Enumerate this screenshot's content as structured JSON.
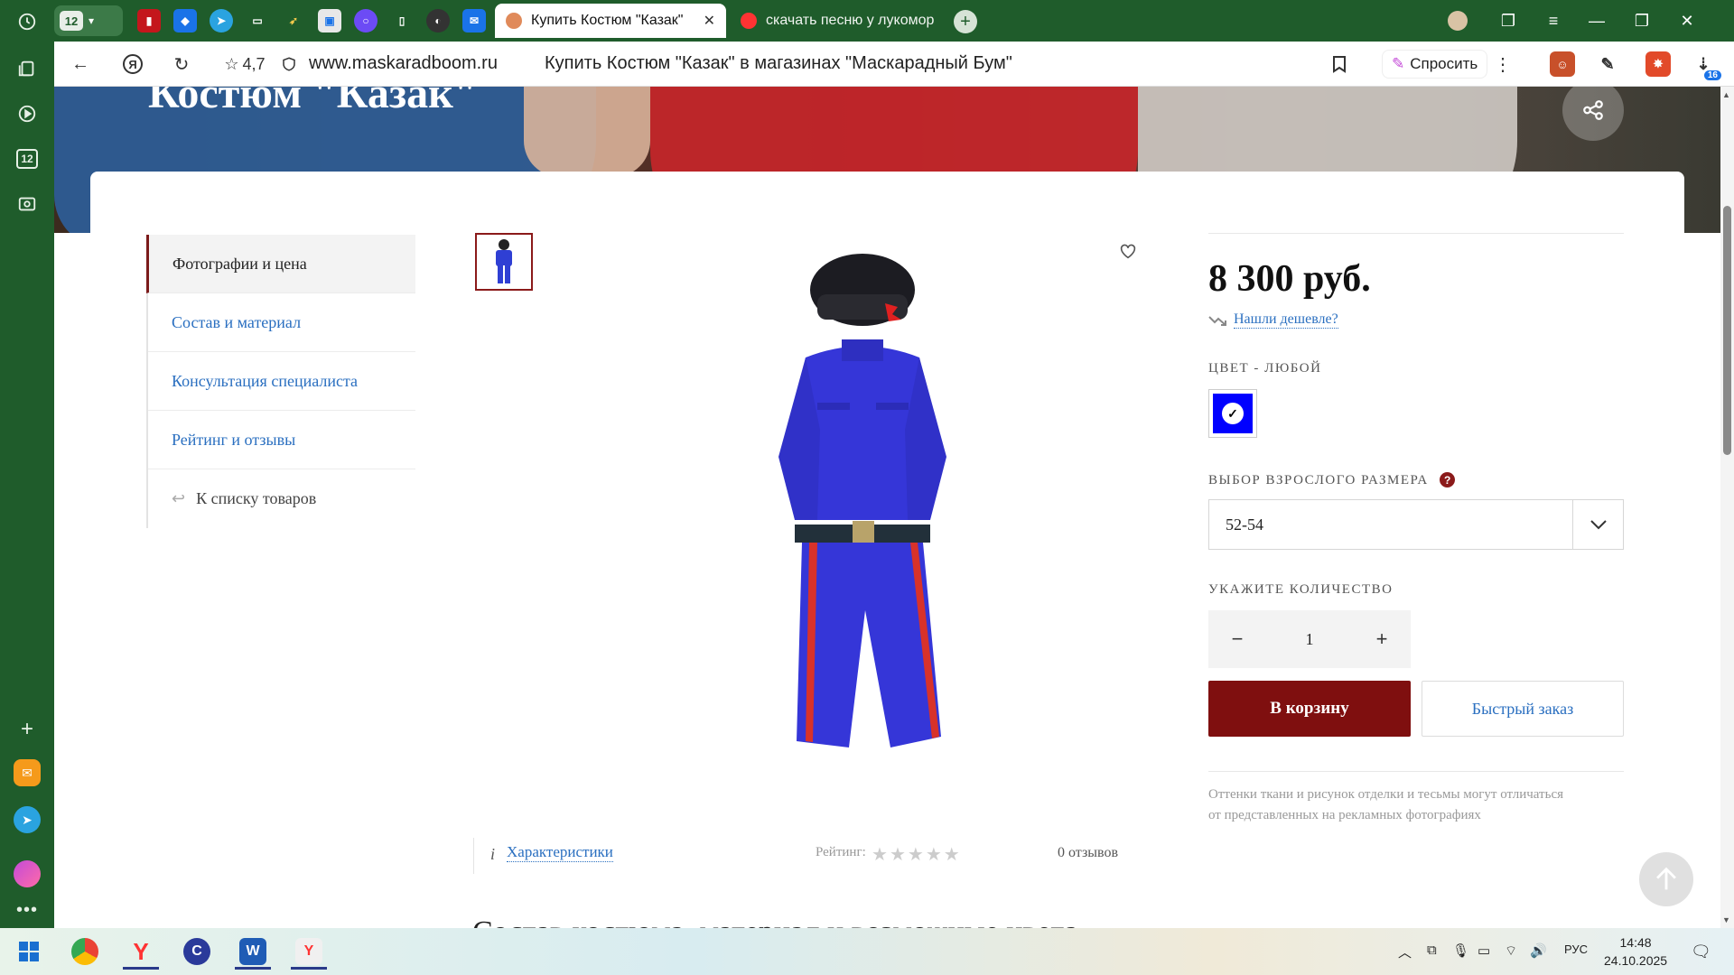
{
  "colors": {
    "chrome_green": "#1f5c2b",
    "brand_red": "#7f0f0f",
    "link_blue": "#2a6fc0",
    "swatch_blue": "#0000ff"
  },
  "browser": {
    "tab_group_count": "12",
    "tabs": [
      {
        "title": "Купить Костюм \"Казак\"",
        "active": true
      },
      {
        "title": "скачать песню у лукомор",
        "active": false
      }
    ],
    "address": {
      "rating": "4,7",
      "host": "www.maskaradboom.ru",
      "page_title": "Купить Костюм \"Казак\" в магазинах \"Маскарадный Бум\""
    },
    "ask_label": "Спросить",
    "ext_badge": "16",
    "rail_badge": "12"
  },
  "hero": {
    "title": "Костюм \"Казак\""
  },
  "sidebar": {
    "items": [
      {
        "label": "Фотографии и цена"
      },
      {
        "label": "Состав и материал"
      },
      {
        "label": "Консультация специалиста"
      },
      {
        "label": "Рейтинг и отзывы"
      }
    ],
    "back_label": "К списку товаров"
  },
  "product": {
    "info_link": "Характеристики",
    "rating_label": "Рейтинг:",
    "rating_value": 0,
    "reviews": "0 отзывов",
    "section_heading": "Состав костюма, материал и возможные цвета"
  },
  "buy": {
    "price": "8 300 руб.",
    "cheaper_link": "Нашли дешевле?",
    "color_label": "ЦВЕТ - ЛЮБОЙ",
    "size_label": "ВЫБОР ВЗРОСЛОГО РАЗМЕРА",
    "size_value": "52-54",
    "qty_label": "УКАЖИТЕ КОЛИЧЕСТВО",
    "qty_value": "1",
    "cart_button": "В корзину",
    "fast_button": "Быстрый заказ",
    "note": "Оттенки ткани и рисунок отделки и тесьмы могут отличаться от представленных на рекламных фотографиях"
  },
  "taskbar": {
    "lang": "РУС",
    "time": "14:48",
    "date": "24.10.2025"
  }
}
